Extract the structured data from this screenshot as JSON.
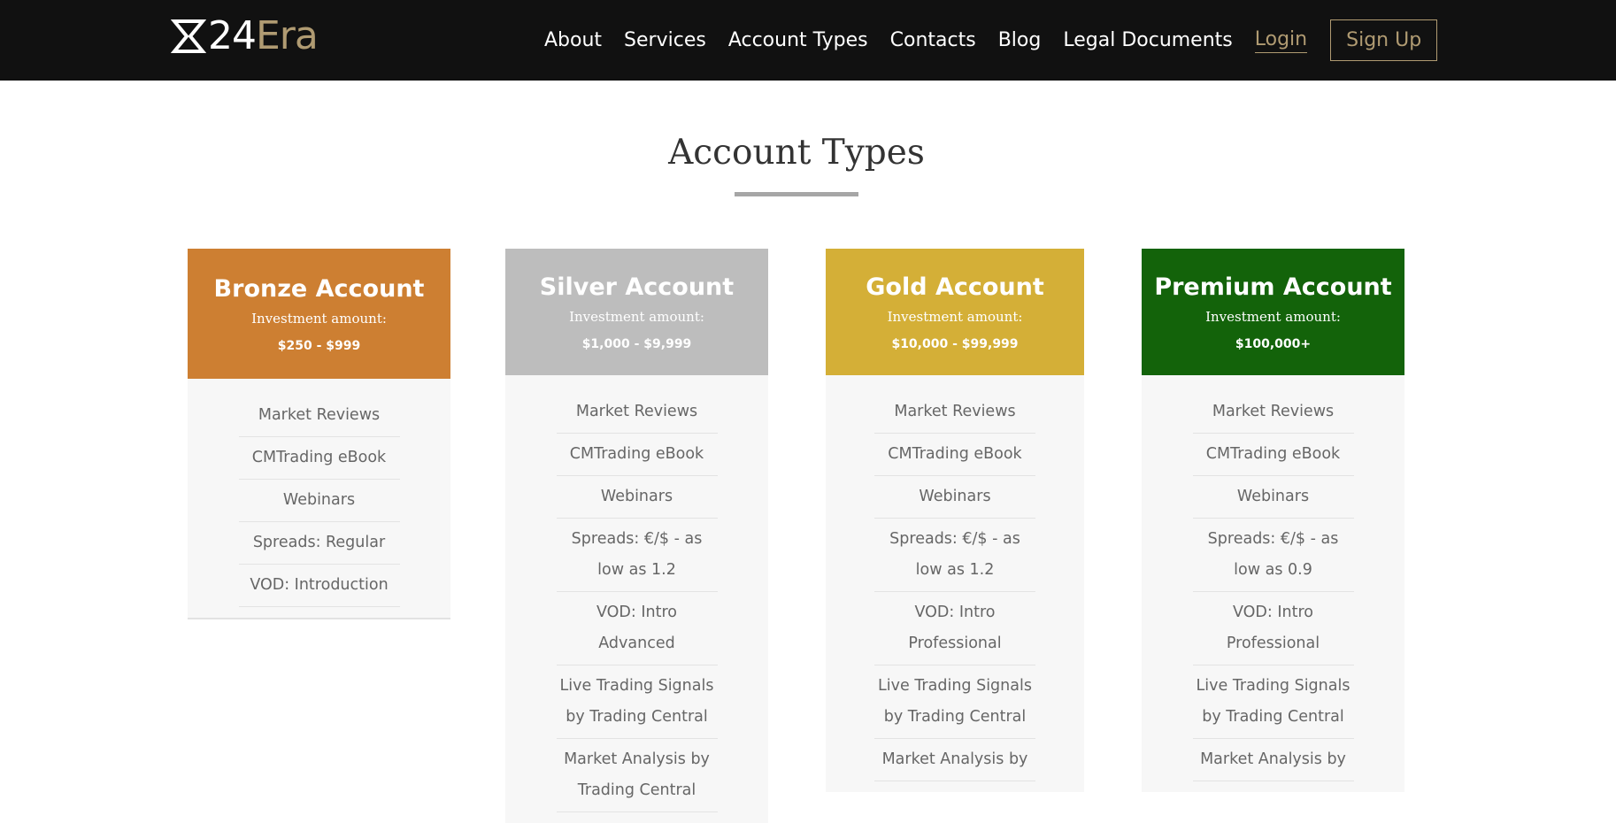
{
  "header": {
    "logo": {
      "number": "24",
      "text": "Era"
    },
    "nav": [
      "About",
      "Services",
      "Account Types",
      "Contacts",
      "Blog",
      "Legal Documents"
    ],
    "login_label": "Login",
    "signup_label": "Sign Up"
  },
  "page": {
    "title": "Account Types"
  },
  "accounts": [
    {
      "name": "Bronze Account",
      "investment_label": "Investment amount:",
      "range": "$250 - $999",
      "color": "#cd7f32",
      "features": [
        "Market Reviews",
        "CMTrading eBook",
        "Webinars",
        "Spreads: Regular",
        "VOD: Introduction"
      ]
    },
    {
      "name": "Silver Account",
      "investment_label": "Investment amount:",
      "range": "$1,000 - $9,999",
      "color": "#bdbdbd",
      "features": [
        "Market Reviews",
        "CMTrading eBook",
        "Webinars",
        "Spreads: €/$ - as low as 1.2",
        "VOD: Intro Advanced",
        "Live Trading Signals by Trading Central",
        "Market Analysis by Trading Central"
      ]
    },
    {
      "name": "Gold Account",
      "investment_label": "Investment amount:",
      "range": "$10,000 - $99,999",
      "color": "#d4af37",
      "features": [
        "Market Reviews",
        "CMTrading eBook",
        "Webinars",
        "Spreads: €/$ - as low as 1.2",
        "VOD: Intro Professional",
        "Live Trading Signals by Trading Central",
        "Market Analysis by"
      ]
    },
    {
      "name": "Premium Account",
      "investment_label": "Investment amount:",
      "range": "$100,000+",
      "color": "#13630a",
      "features": [
        "Market Reviews",
        "CMTrading eBook",
        "Webinars",
        "Spreads: €/$ - as low as 0.9",
        "VOD: Intro Professional",
        "Live Trading Signals by Trading Central",
        "Market Analysis by"
      ]
    }
  ],
  "colors": {
    "header_bg": "#111111",
    "accent": "#b09b72",
    "card_body_bg": "#f7f7f7"
  }
}
